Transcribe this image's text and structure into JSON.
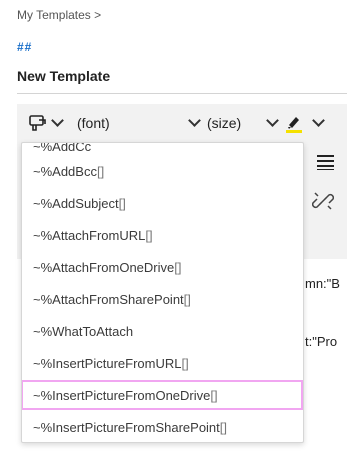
{
  "breadcrumb": "My Templates >",
  "hashes": "##",
  "template_name": "New Template",
  "toolbar": {
    "font": "(font)",
    "size": "(size)",
    "highlight_color": "#f5e100"
  },
  "background_text": {
    "line1": "mn:\"B",
    "line2": "t:\"Pro"
  },
  "dropdown": {
    "items": [
      {
        "label": "~%AddBcc",
        "suffix": "[]"
      },
      {
        "label": "~%AddSubject",
        "suffix": "[]"
      },
      {
        "label": "~%AttachFromURL",
        "suffix": "[]"
      },
      {
        "label": "~%AttachFromOneDrive",
        "suffix": "[]"
      },
      {
        "label": "~%AttachFromSharePoint",
        "suffix": "[]"
      },
      {
        "label": "~%WhatToAttach",
        "suffix": ""
      },
      {
        "label": "~%InsertPictureFromURL",
        "suffix": "[]"
      },
      {
        "label": "~%InsertPictureFromOneDrive",
        "suffix": "[]"
      },
      {
        "label": "~%InsertPictureFromSharePoint",
        "suffix": "[]"
      }
    ],
    "selected_index": 7,
    "selection_color": "#f1a6f1"
  }
}
